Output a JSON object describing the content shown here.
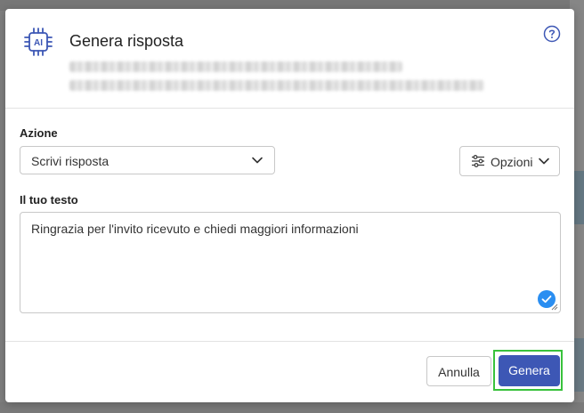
{
  "dialog": {
    "title": "Genera risposta",
    "ai_icon_label": "AI",
    "help_icon": "question-circle-icon"
  },
  "form": {
    "action_label": "Azione",
    "action_value": "Scrivi risposta",
    "options_label": "Opzioni",
    "text_label": "Il tuo testo",
    "text_value": "Ringrazia per l'invito ricevuto e chiedi maggiori informazioni"
  },
  "footer": {
    "cancel_label": "Annulla",
    "generate_label": "Genera"
  },
  "colors": {
    "primary": "#3d57b5",
    "focus": "#39c23c",
    "check": "#2a8ef1",
    "ai_icon": "#3d57b5"
  }
}
